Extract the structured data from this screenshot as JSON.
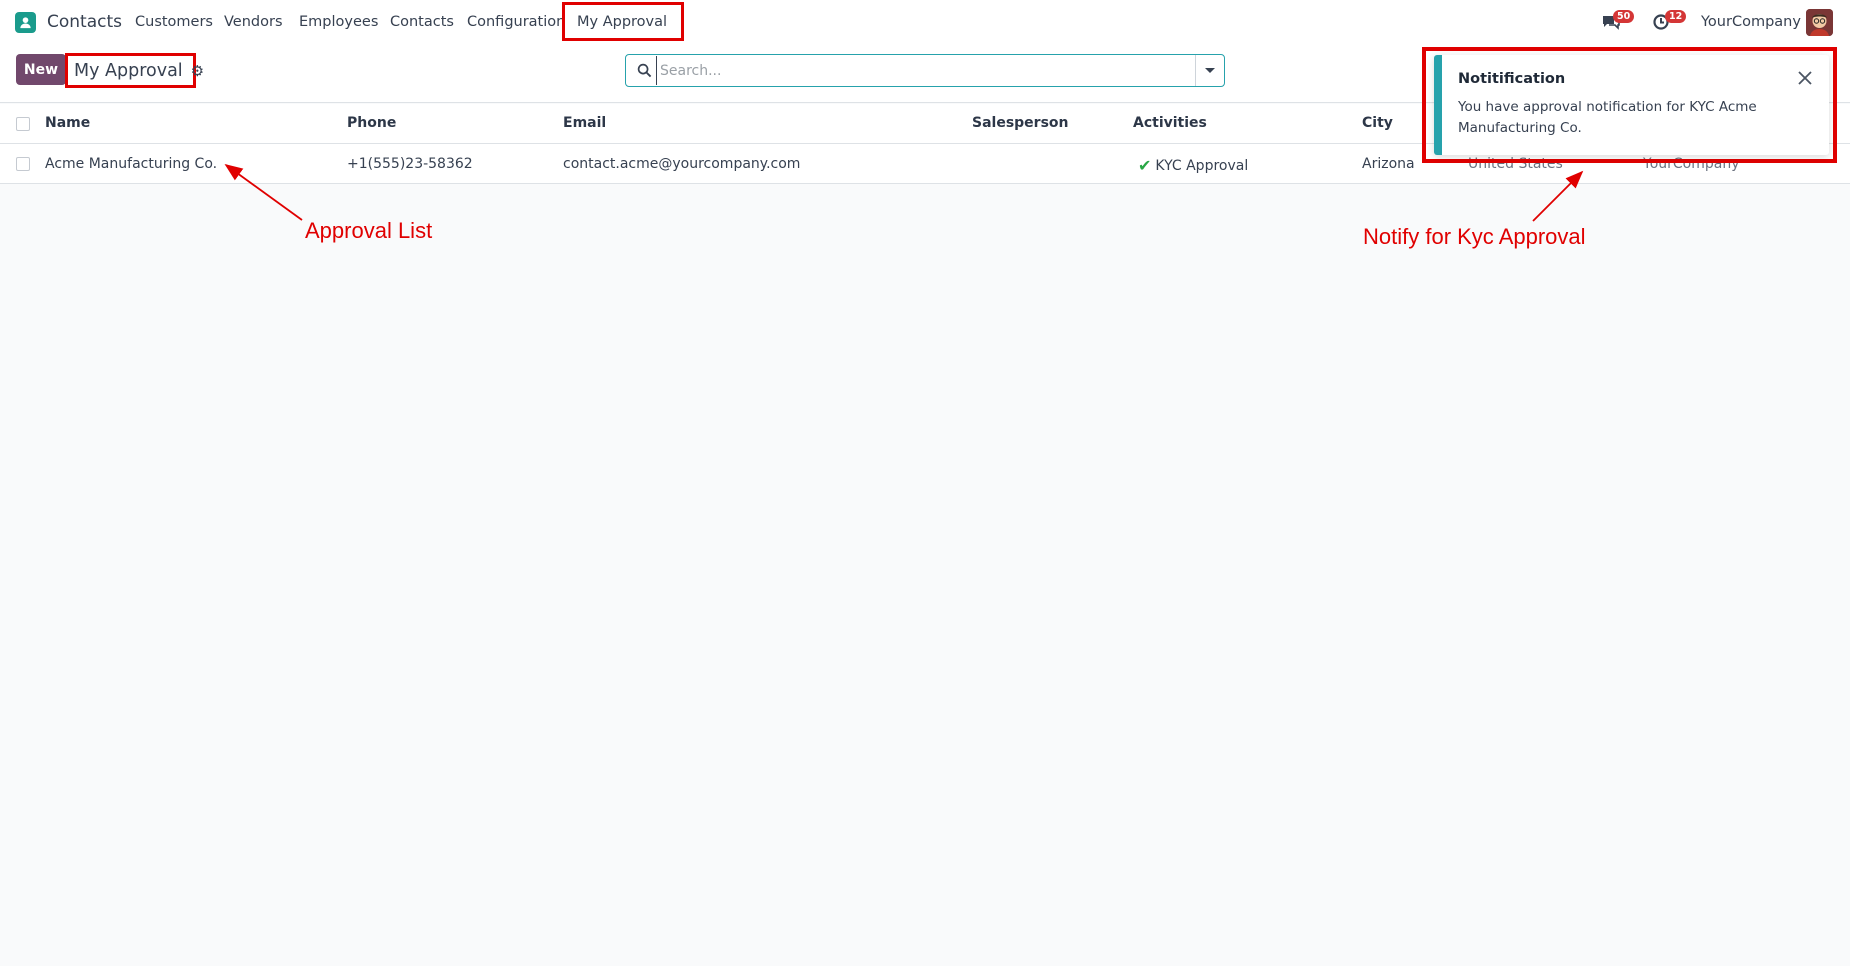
{
  "navbar": {
    "app_name": "Contacts",
    "menu": [
      "Customers",
      "Vendors",
      "Employees",
      "Contacts",
      "Configuration",
      "My Approval"
    ],
    "messages_badge": "50",
    "activities_badge": "12",
    "company": "YourCompany"
  },
  "control": {
    "new_label": "New",
    "breadcrumb_title": "My Approval",
    "search_placeholder": "Search..."
  },
  "table": {
    "columns": [
      "Name",
      "Phone",
      "Email",
      "Salesperson",
      "Activities",
      "City"
    ],
    "rows": [
      {
        "name": "Acme Manufacturing Co.",
        "phone": "+1(555)23-58362",
        "email": "contact.acme@yourcompany.com",
        "salesperson": "",
        "activity": "KYC Approval",
        "city": "Arizona",
        "country": "United States",
        "company": "YourCompany"
      }
    ]
  },
  "notification": {
    "title": "Notitification",
    "body": "You have approval notification for KYC Acme Manufacturing Co."
  },
  "annotations": {
    "approval_list": "Approval List",
    "notify": "Notify for Kyc Approval"
  },
  "colors": {
    "primary": "#71486c",
    "accent": "#26a2ac",
    "annotation": "#e00000",
    "badge": "#d43636",
    "success": "#28a745"
  }
}
